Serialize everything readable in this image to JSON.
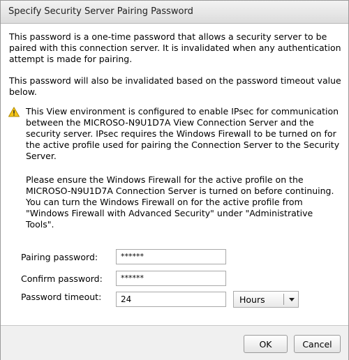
{
  "dialog": {
    "title": "Specify Security Server Pairing Password",
    "intro_1": "This password is a one-time password that allows a security server to be paired with this connection server. It is invalidated when any authentication attempt is made for pairing.",
    "intro_2": "This password will also be invalidated based on the password timeout value below.",
    "warning_icon": "warning-triangle-icon",
    "warning_1": "This View environment is configured to enable IPsec for communication between the MICROSO-N9U1D7A View Connection Server and the security server. IPsec requires the Windows Firewall to be turned on for the active profile used for pairing the Connection Server to the Security Server.",
    "warning_2": "Please ensure the Windows Firewall for the active profile on the MICROSO-N9U1D7A Connection Server is turned on before continuing. You can turn the Windows Firewall on for the active profile from \"Windows Firewall with Advanced Security\" under \"Administrative Tools\"."
  },
  "form": {
    "pairing_password_label": "Pairing password:",
    "pairing_password_value": "******",
    "confirm_password_label": "Confirm password:",
    "confirm_password_value": "******",
    "timeout_label": "Password timeout:",
    "timeout_value": "24",
    "timeout_unit": "Hours"
  },
  "buttons": {
    "ok": "OK",
    "cancel": "Cancel"
  },
  "colors": {
    "warning_fill": "#f5c518",
    "title_bar": "#e4e4e4",
    "footer": "#f0f0f0"
  }
}
